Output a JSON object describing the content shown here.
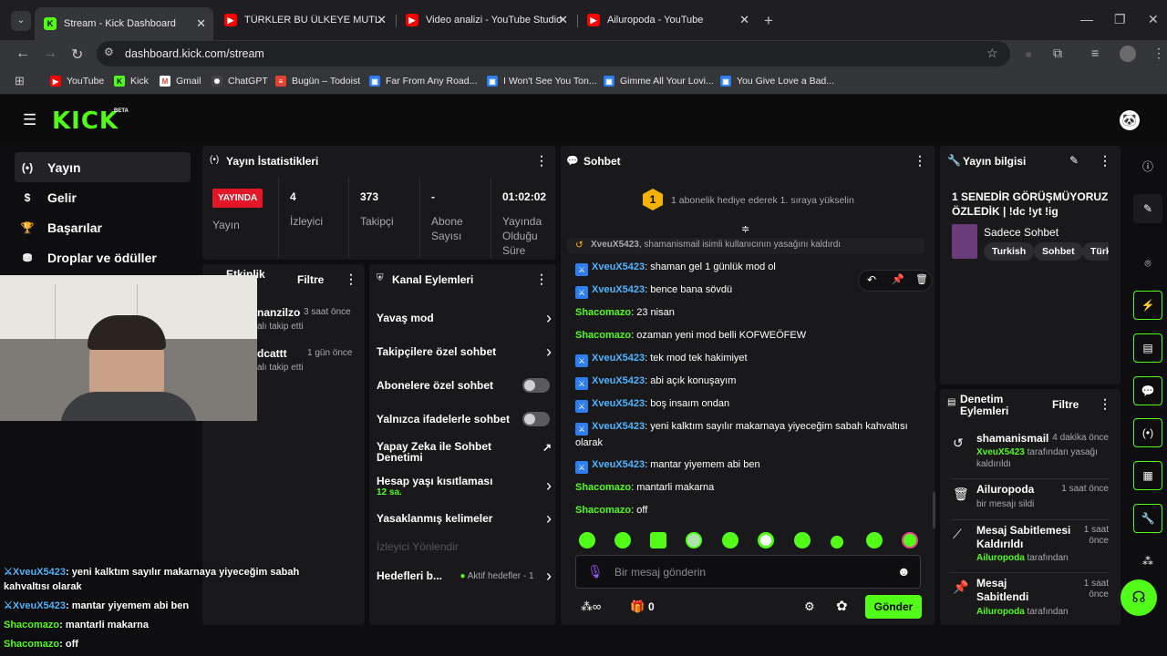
{
  "browser": {
    "tabs": [
      {
        "title": "Stream - Kick Dashboard",
        "color": "#53fc18"
      },
      {
        "title": "TÜRKLER BU ÜLKEYE MUTLAKA",
        "color": "#ff0000"
      },
      {
        "title": "Video analizi - YouTube Studio",
        "color": "#ff0000"
      },
      {
        "title": "Ailuropoda - YouTube",
        "color": "#ff0000"
      }
    ],
    "url": "dashboard.kick.com/stream",
    "bookmarks": [
      {
        "label": "YouTube",
        "color": "#ff0000"
      },
      {
        "label": "Kick",
        "color": "#53fc18"
      },
      {
        "label": "Gmail",
        "color": "#ea4335"
      },
      {
        "label": "ChatGPT",
        "color": "#cccccc"
      },
      {
        "label": "Bugün – Todoist",
        "color": "#e44332"
      },
      {
        "label": "Far From Any Road...",
        "color": "#2f7ef0"
      },
      {
        "label": "I Won't See You Ton...",
        "color": "#2f7ef0"
      },
      {
        "label": "Gimme All Your Lovi...",
        "color": "#2f7ef0"
      },
      {
        "label": "You Give Love a Bad...",
        "color": "#2f7ef0"
      }
    ]
  },
  "kick": {
    "logo": "KICK",
    "beta": "BETA",
    "accent": "#53fc18"
  },
  "nav": [
    "Yayın",
    "Gelir",
    "Başarılar",
    "Droplar ve ödüller"
  ],
  "stats": {
    "title": "Yayın İstatistikleri",
    "live_badge": "YAYINDA",
    "live_label": "Yayın",
    "items": [
      {
        "value": "4",
        "label": "İzleyici"
      },
      {
        "value": "373",
        "label": "Takipçi"
      },
      {
        "value": "-",
        "label": "Abone Sayısı"
      },
      {
        "value": "01:02:02",
        "label": "Yayında Olduğu Süre"
      }
    ]
  },
  "activity": {
    "title": "Etkinlik",
    "filter": "Filtre",
    "items": [
      {
        "user": "nanzilzo",
        "time": "3 saat önce",
        "text": "alı takip etti"
      },
      {
        "user": "dcattt",
        "time": "1 gün önce",
        "text": "alı takip etti"
      }
    ]
  },
  "channel_actions": {
    "title": "Kanal Eylemleri",
    "slow_mode": "Yavaş mod",
    "followers_only": "Takipçilere özel sohbet",
    "subs_only": "Abonelere özel sohbet",
    "emotes_only": "Yalnızca ifadelerle sohbet",
    "ai_moderation": "Yapay Zeka ile Sohbet Denetimi",
    "account_age": "Hesap yaşı kısıtlaması",
    "account_age_value": "12 sa.",
    "banned_words": "Yasaklanmış kelimeler",
    "viewer_redirect": "İzleyici Yönlendir",
    "goals": "Hedefleri b...",
    "goals_status": "Aktif hedefler - 1"
  },
  "chat": {
    "title": "Sohbet",
    "gift_banner": "1 abonelik hediye ederek 1. sıraya yükselin",
    "gift_rank": "1",
    "system": {
      "user": "XveuX5423",
      "text": ", shamanismail isimli kullanıcının yasağını kaldırdı"
    },
    "messages": [
      {
        "user": "XveuX5423",
        "text": ": shaman gel 1 günlük mod ol",
        "kind": "mod"
      },
      {
        "user": "XveuX5423",
        "text": ": bence bana sövdü",
        "kind": "mod"
      },
      {
        "user": "Shacomazo",
        "text": ": 23 nisan",
        "kind": "owner"
      },
      {
        "user": "Shacomazo",
        "text": ": ozaman yeni mod belli KOFWEÖFEW",
        "kind": "owner"
      },
      {
        "user": "XveuX5423",
        "text": ": tek mod tek hakimiyet",
        "kind": "mod"
      },
      {
        "user": "XveuX5423",
        "text": ": abi açık konuşayım",
        "kind": "mod"
      },
      {
        "user": "XveuX5423",
        "text": ": boş insaım ondan",
        "kind": "mod"
      },
      {
        "user": "XveuX5423",
        "text": ": yeni kalktım sayılır makarnaya yiyeceğim sabah kahvaltısı olarak",
        "kind": "mod"
      },
      {
        "user": "XveuX5423",
        "text": ": mantar yiyemem abi ben",
        "kind": "mod"
      },
      {
        "user": "Shacomazo",
        "text": ": mantarli makarna",
        "kind": "owner"
      },
      {
        "user": "Shacomazo",
        "text": ": off",
        "kind": "owner"
      }
    ],
    "input_placeholder": "Bir mesaj gönderin",
    "points": "0",
    "send": "Gönder"
  },
  "stream_info": {
    "title_label": "Yayın bilgisi",
    "stream_title": "1 SENEDİR GÖRÜŞMÜYORUZ ÖZLEDİK | !dc !yt !ig",
    "category": "Sadece Sohbet",
    "tags": [
      "Turkish",
      "Sohbet",
      "Türk"
    ]
  },
  "moderation": {
    "title": "Denetim Eylemleri",
    "filter": "Filtre",
    "items": [
      {
        "user": "shamanismail",
        "time": "4 dakika önce",
        "who": "XveuX5423",
        "sub": " tarafından yasağı kaldırıldı"
      },
      {
        "user": "Ailuropoda",
        "time": "1 saat önce",
        "who": "",
        "sub": "bir mesajı sildi"
      },
      {
        "user": "Mesaj Sabitlemesi Kaldırıldı",
        "time": "1 saat önce",
        "who": "Ailuropoda",
        "sub": " tarafından"
      },
      {
        "user": "Mesaj Sabitlendi",
        "time": "1 saat önce",
        "who": "Ailuropoda",
        "sub": " tarafından"
      }
    ]
  },
  "overlay": [
    {
      "user": "XveuX5423",
      "text": ": yeni kalktım sayılır makarnaya yiyeceğim sabah kahvaltısı olarak"
    },
    {
      "user": "XveuX5423",
      "text": ": mantar yiyemem abi ben"
    },
    {
      "user": "Shacomazo",
      "text": ": mantarli makarna"
    },
    {
      "user": "Shacomazo",
      "text": ": off"
    }
  ]
}
